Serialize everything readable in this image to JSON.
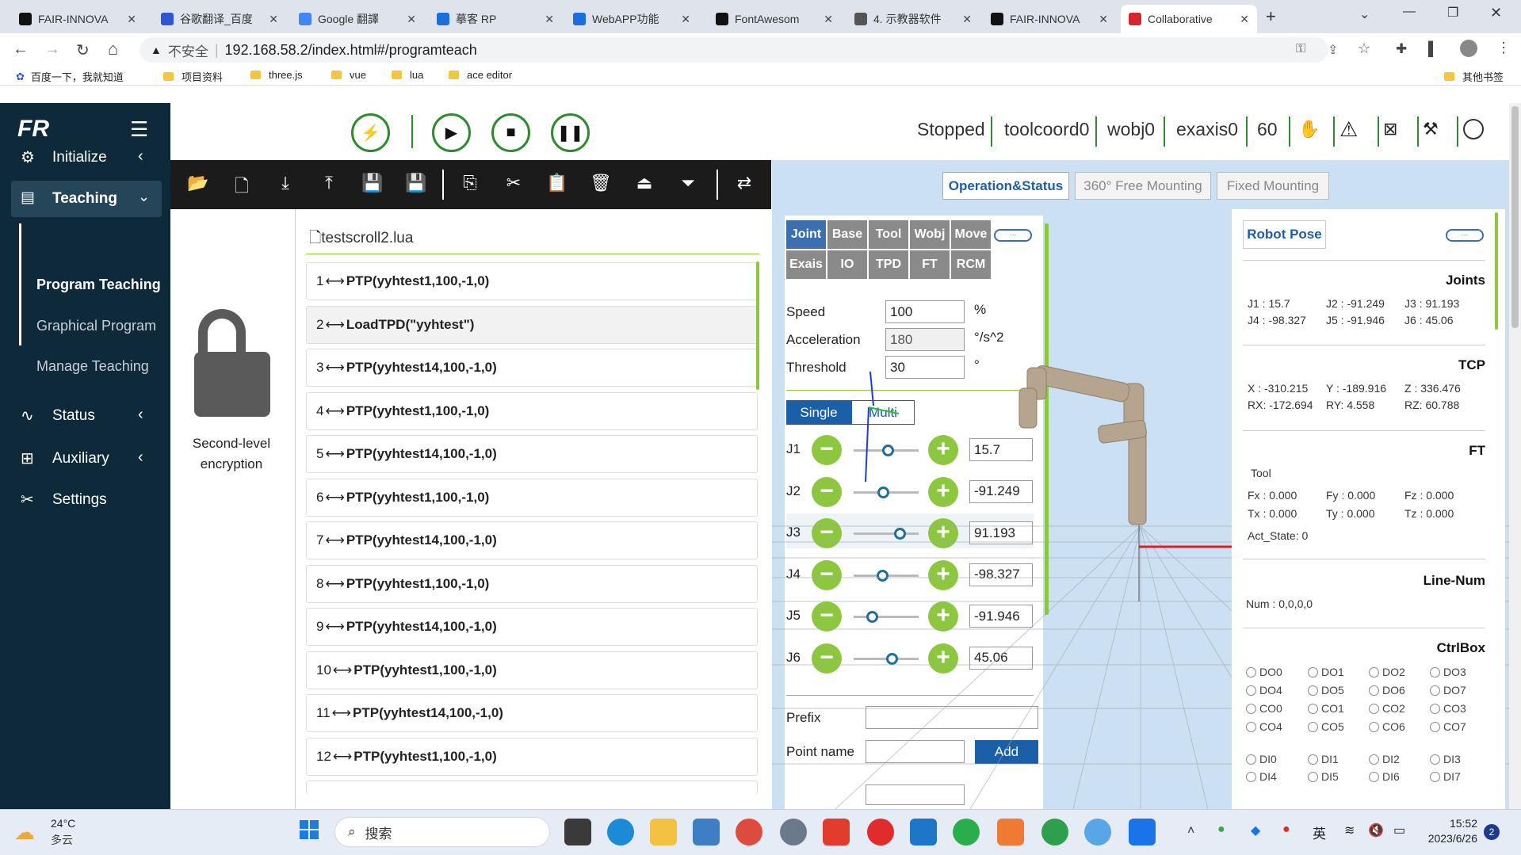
{
  "browser": {
    "tabs": [
      {
        "label": "FAIR-INNOVA",
        "icon": "github-icon"
      },
      {
        "label": "谷歌翻译_百度",
        "icon": "baidu-icon"
      },
      {
        "label": "Google 翻譯",
        "icon": "google-translate-icon"
      },
      {
        "label": "摹客 RP",
        "icon": "mockplus-icon"
      },
      {
        "label": "WebAPP功能",
        "icon": "mockplus-icon"
      },
      {
        "label": "FontAwesom",
        "icon": "fontawesome-icon"
      },
      {
        "label": "4. 示教器软件",
        "icon": "doc-icon"
      },
      {
        "label": "FAIR-INNOVA",
        "icon": "github-icon"
      },
      {
        "label": "Collaborative",
        "icon": "fr-icon"
      }
    ],
    "security": "不安全",
    "url": "192.168.58.2/index.html#/programteach",
    "bookmarks": [
      "百度一下，我就知道",
      "项目资料",
      "three.js",
      "vue",
      "lua",
      "ace editor"
    ],
    "other_bookmarks": "其他书签"
  },
  "sidebar": {
    "logo": "FR",
    "items": [
      {
        "label": "Initialize",
        "icon": "gear-icon"
      },
      {
        "label": "Teaching",
        "icon": "list-icon"
      },
      {
        "label": "Status",
        "icon": "pulse-icon"
      },
      {
        "label": "Auxiliary",
        "icon": "grid-icon"
      },
      {
        "label": "Settings",
        "icon": "tools-icon"
      }
    ],
    "sub_items": [
      "Program Teaching",
      "Graphical Program",
      "Manage Teaching"
    ]
  },
  "topbar": {
    "state": "Stopped",
    "toolcoord": "toolcoord0",
    "wobj": "wobj0",
    "exaxis": "exaxis0",
    "speed": "60"
  },
  "lock": {
    "label": "Second-level encryption"
  },
  "file": {
    "name": "testscroll2.lua",
    "lines": [
      {
        "no": "1",
        "code": "PTP(yyhtest1,100,-1,0)"
      },
      {
        "no": "2",
        "code": "LoadTPD(\"yyhtest\")"
      },
      {
        "no": "3",
        "code": "PTP(yyhtest14,100,-1,0)"
      },
      {
        "no": "4",
        "code": "PTP(yyhtest1,100,-1,0)"
      },
      {
        "no": "5",
        "code": "PTP(yyhtest14,100,-1,0)"
      },
      {
        "no": "6",
        "code": "PTP(yyhtest1,100,-1,0)"
      },
      {
        "no": "7",
        "code": "PTP(yyhtest14,100,-1,0)"
      },
      {
        "no": "8",
        "code": "PTP(yyhtest1,100,-1,0)"
      },
      {
        "no": "9",
        "code": "PTP(yyhtest14,100,-1,0)"
      },
      {
        "no": "10",
        "code": "PTP(yyhtest1,100,-1,0)"
      },
      {
        "no": "11",
        "code": "PTP(yyhtest14,100,-1,0)"
      },
      {
        "no": "12",
        "code": "PTP(yyhtest1,100,-1,0)"
      }
    ]
  },
  "view_tabs": [
    "Operation&Status",
    "360° Free Mounting",
    "Fixed Mounting"
  ],
  "jog": {
    "tabs_row1": [
      "Joint",
      "Base",
      "Tool",
      "Wobj",
      "Move"
    ],
    "tabs_row2": [
      "Exais",
      "IO",
      "TPD",
      "FT",
      "RCM"
    ],
    "speed_label": "Speed",
    "speed": "100",
    "speed_unit": "%",
    "acc_label": "Acceleration",
    "acc": "180",
    "acc_unit": "°/s^2",
    "thr_label": "Threshold",
    "thr": "30",
    "thr_unit": "°",
    "mode_single": "Single",
    "mode_multi": "Multi",
    "joints": [
      {
        "name": "J1",
        "value": "15.7",
        "level": 0.53
      },
      {
        "name": "J2",
        "value": "-91.249",
        "level": 0.45
      },
      {
        "name": "J3",
        "value": "91.193",
        "level": 0.71
      },
      {
        "name": "J4",
        "value": "-98.327",
        "level": 0.44
      },
      {
        "name": "J5",
        "value": "-91.946",
        "level": 0.28
      },
      {
        "name": "J6",
        "value": "45.06",
        "level": 0.59
      }
    ],
    "prefix_label": "Prefix",
    "point_label": "Point name",
    "add_label": "Add"
  },
  "pose": {
    "title": "Robot Pose",
    "joints_h": "Joints",
    "joints": [
      "J1 : 15.7",
      "J2 : -91.249",
      "J3 : 91.193",
      "J4 : -98.327",
      "J5 : -91.946",
      "J6 : 45.06"
    ],
    "tcp_h": "TCP",
    "tcp": [
      "X   : -310.215",
      "Y   : -189.916",
      "Z   : 336.476",
      "RX: -172.694",
      "RY: 4.558",
      "RZ: 60.788"
    ],
    "ft_h": "FT",
    "ft_tool": "Tool",
    "ft": [
      "Fx : 0.000",
      "Fy : 0.000",
      "Fz : 0.000",
      "Tx : 0.000",
      "Ty : 0.000",
      "Tz : 0.000"
    ],
    "act_state": "Act_State: 0",
    "line_h": "Line-Num",
    "line_num": "Num   :   0,0,0,0",
    "ctrl_h": "CtrlBox",
    "do": [
      "DO0",
      "DO1",
      "DO2",
      "DO3",
      "DO4",
      "DO5",
      "DO6",
      "DO7"
    ],
    "co": [
      "CO0",
      "CO1",
      "CO2",
      "CO3",
      "CO4",
      "CO5",
      "CO6",
      "CO7"
    ],
    "di": [
      "DI0",
      "DI1",
      "DI2",
      "DI3",
      "DI4",
      "DI5",
      "DI6",
      "DI7"
    ]
  },
  "taskbar": {
    "weather_temp": "24°C",
    "weather_desc": "多云",
    "search": "搜索",
    "ime": "英",
    "time": "15:52",
    "date": "2023/6/26",
    "badge": "2"
  }
}
